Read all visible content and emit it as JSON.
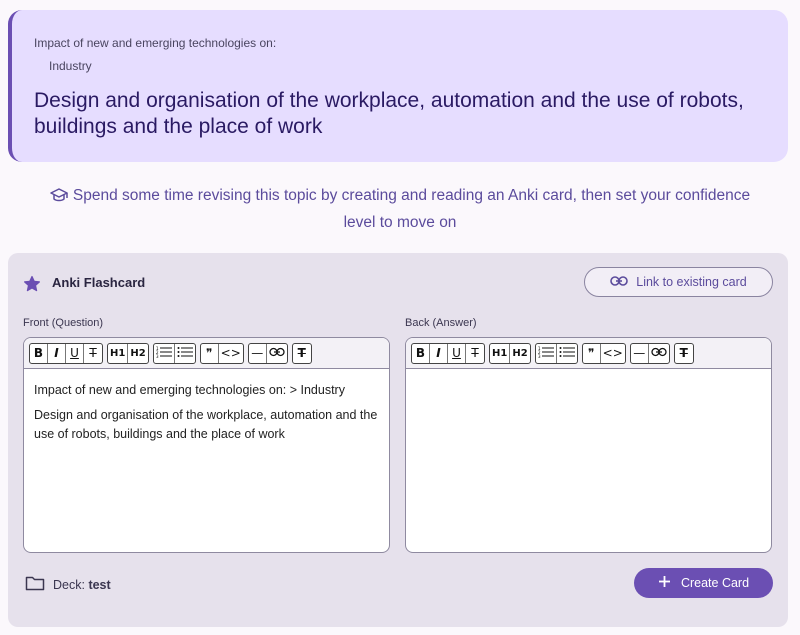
{
  "topic": {
    "parent": "Impact of new and emerging technologies on:",
    "child": "Industry",
    "title": "Design and organisation of the workplace, automation and the use of robots, buildings and the place of work"
  },
  "hint": {
    "icon": "graduation-cap-icon",
    "text": "Spend some time revising this topic by creating and reading an Anki card, then set your confidence level to move on"
  },
  "anki": {
    "title": "Anki Flashcard",
    "title_icon": "star-icon",
    "link_button": "Link to existing card",
    "front_label": "Front (Question)",
    "back_label": "Back (Answer)",
    "front_lines": [
      "Impact of new and emerging technologies on: > Industry",
      "Design and organisation of the workplace, automation and the use of robots, buildings and the place of work"
    ],
    "back_text": "",
    "toolbar": {
      "bold": "B",
      "italic": "I",
      "underline": "U",
      "strike": "T",
      "h1": "H1",
      "h2": "H2",
      "ol": "",
      "ul": "",
      "quote": "❞",
      "code": "<>",
      "hr": "—",
      "link": "",
      "clear": "T"
    },
    "deck_label": "Deck:",
    "deck_name": "test",
    "create_button": "Create Card"
  },
  "colors": {
    "accent": "#6b4fb3",
    "topic_bg": "#e6ddff",
    "panel_bg": "#e6e1ec"
  }
}
